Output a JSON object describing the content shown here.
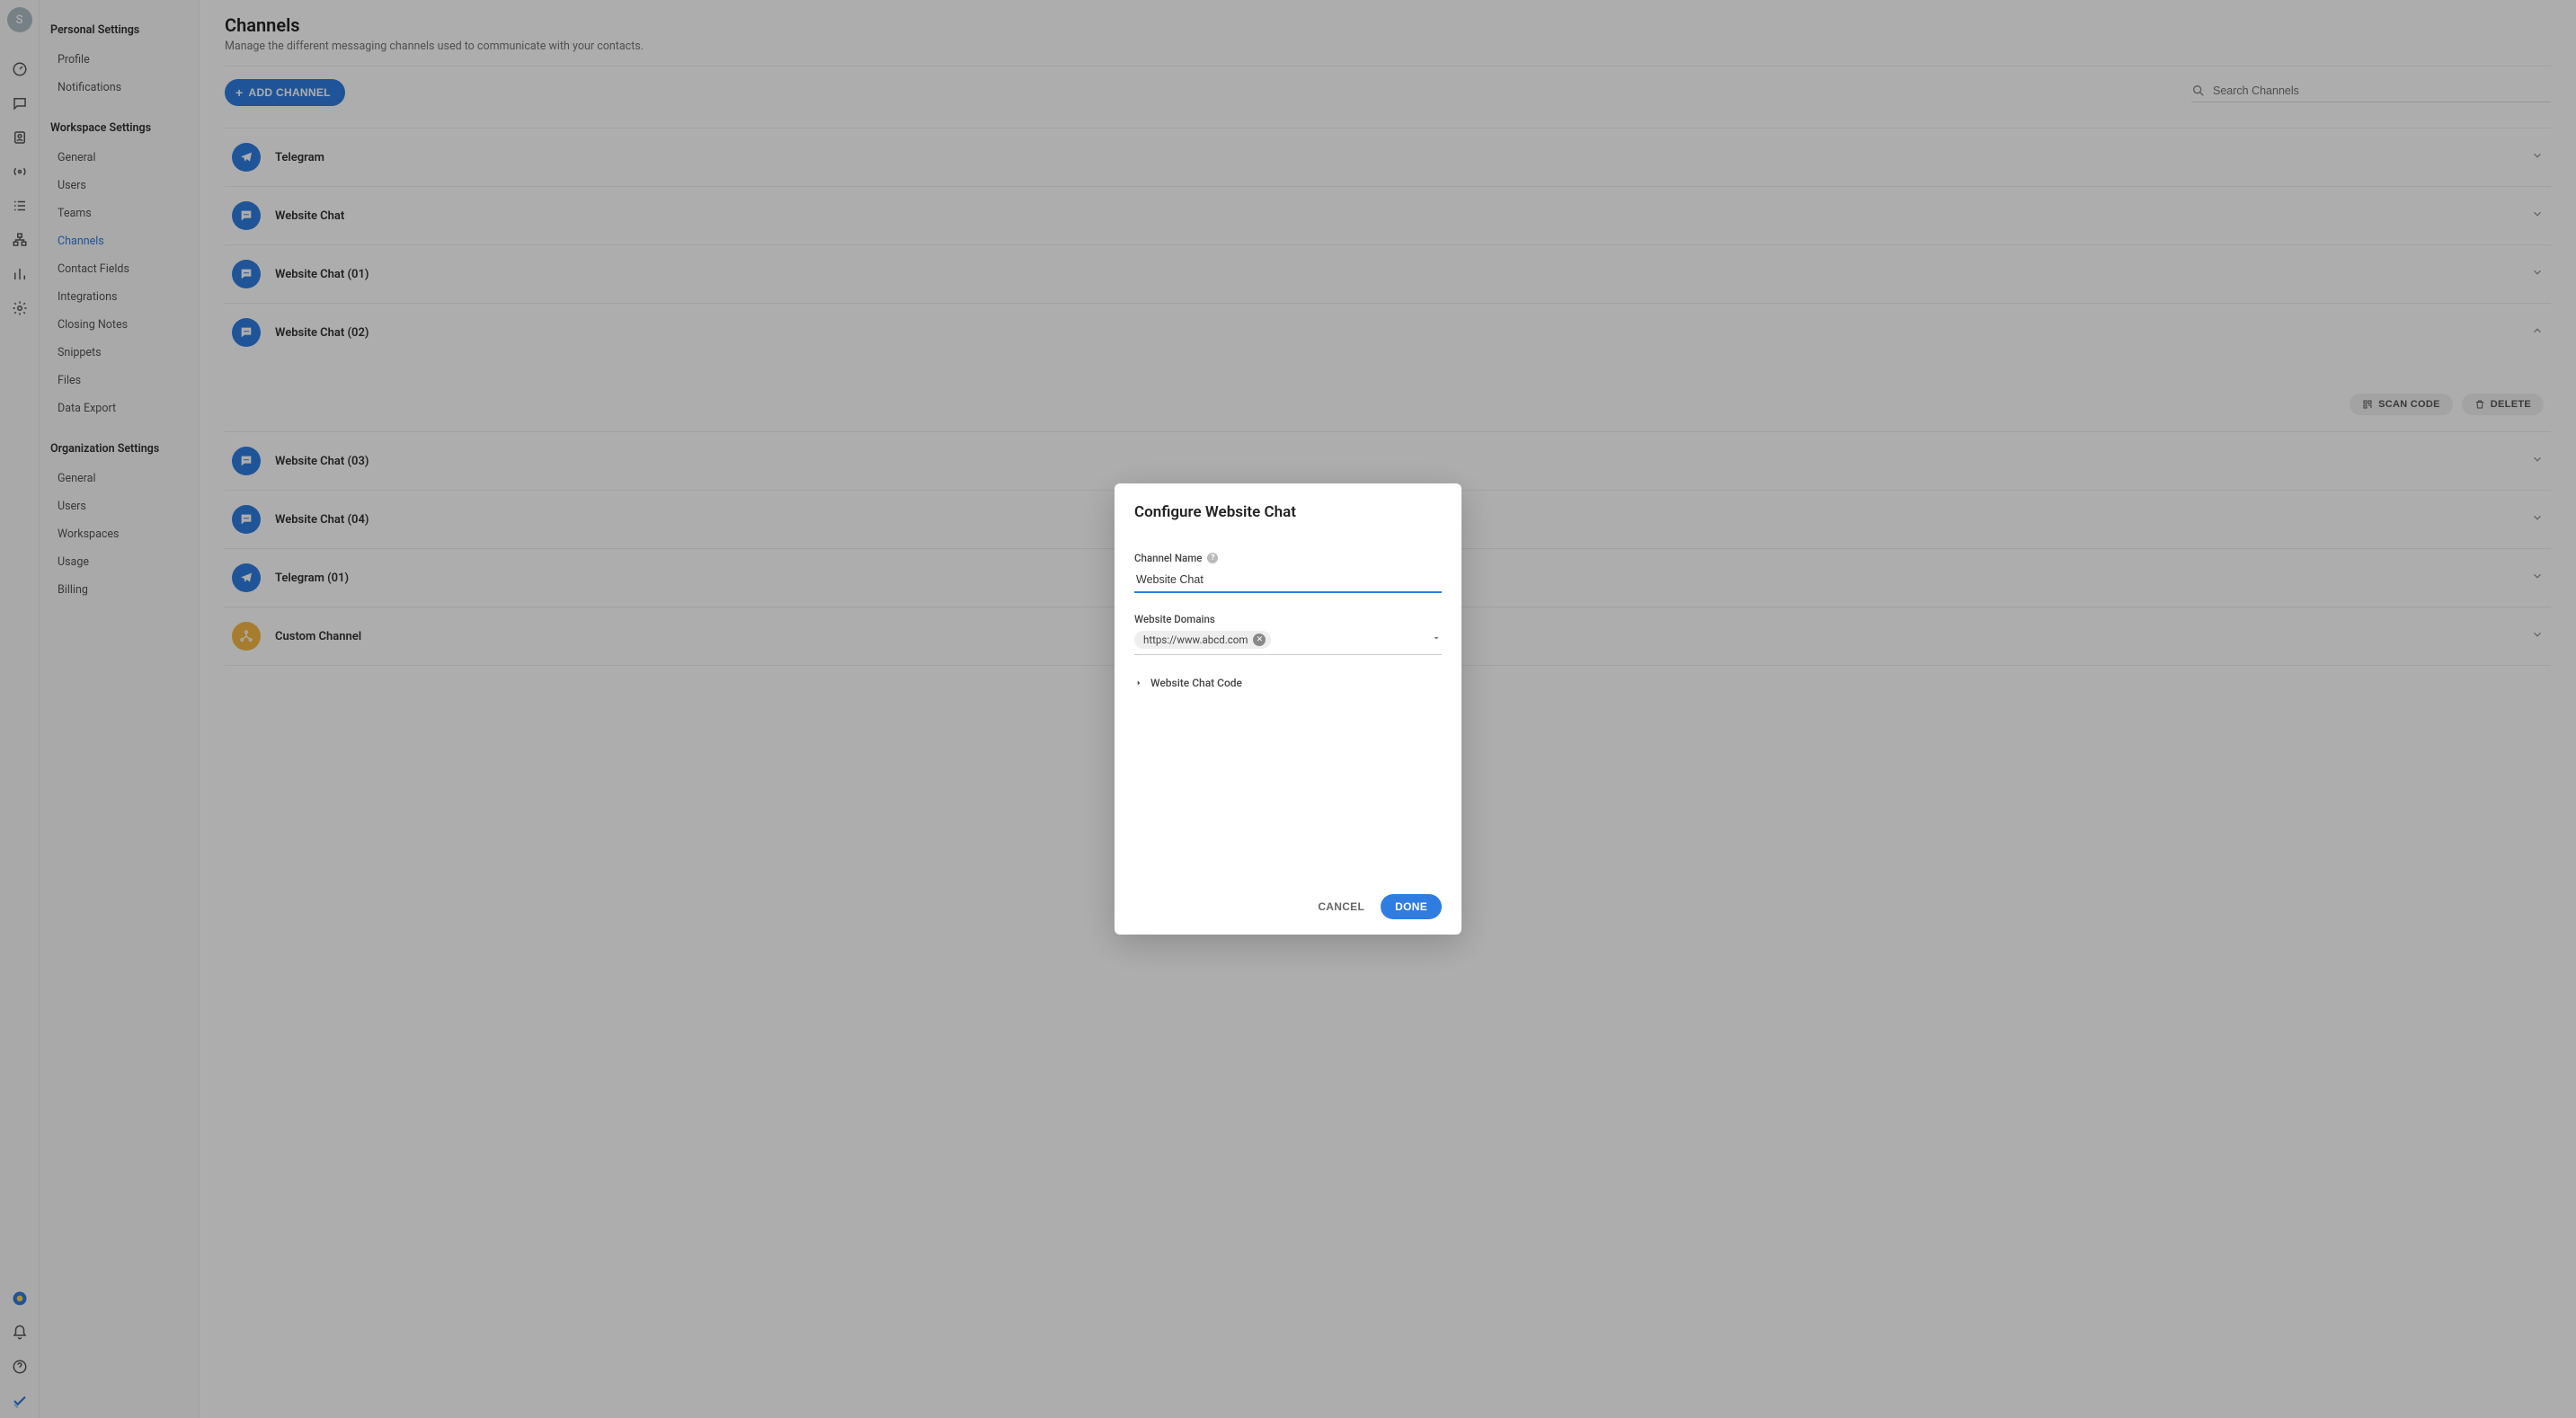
{
  "avatar_initial": "S",
  "sidebar": {
    "personal_title": "Personal Settings",
    "personal_items": [
      "Profile",
      "Notifications"
    ],
    "workspace_title": "Workspace Settings",
    "workspace_items": [
      "General",
      "Users",
      "Teams",
      "Channels",
      "Contact Fields",
      "Integrations",
      "Closing Notes",
      "Snippets",
      "Files",
      "Data Export"
    ],
    "workspace_active_index": 3,
    "org_title": "Organization Settings",
    "org_items": [
      "General",
      "Users",
      "Workspaces",
      "Usage",
      "Billing"
    ]
  },
  "page": {
    "title": "Channels",
    "subtitle": "Manage the different messaging channels used to communicate with your contacts.",
    "add_channel_button": "ADD CHANNEL",
    "search_placeholder": "Search Channels"
  },
  "channels": [
    {
      "name": "Telegram",
      "icon": "telegram",
      "expanded": false
    },
    {
      "name": "Website Chat",
      "icon": "chat",
      "expanded": false
    },
    {
      "name": "Website Chat (01)",
      "icon": "chat",
      "expanded": false
    },
    {
      "name": "Website Chat (02)",
      "icon": "chat",
      "expanded": true
    },
    {
      "name": "Website Chat (03)",
      "icon": "chat",
      "expanded": false
    },
    {
      "name": "Website Chat (04)",
      "icon": "chat",
      "expanded": false
    },
    {
      "name": "Telegram (01)",
      "icon": "telegram",
      "expanded": false
    },
    {
      "name": "Custom Channel",
      "icon": "custom",
      "expanded": false
    }
  ],
  "channel_actions": {
    "scan_code": "SCAN CODE",
    "delete": "DELETE"
  },
  "modal": {
    "title": "Configure Website Chat",
    "channel_name_label": "Channel Name",
    "channel_name_value": "Website Chat",
    "domains_label": "Website Domains",
    "domain_chip": "https://www.abcd.com",
    "code_toggle_label": "Website Chat Code",
    "cancel": "CANCEL",
    "done": "DONE"
  }
}
